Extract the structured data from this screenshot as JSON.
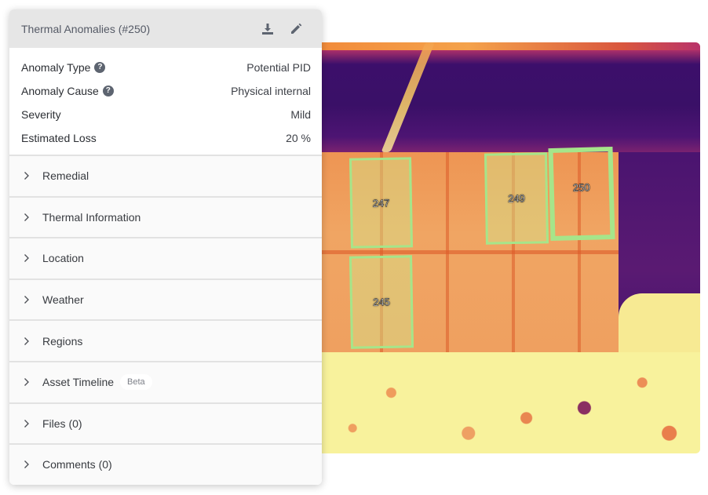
{
  "panel": {
    "title": "Thermal Anomalies (#250)",
    "actions": [
      {
        "name": "download",
        "icon": "download-icon"
      },
      {
        "name": "edit",
        "icon": "pencil-icon"
      }
    ],
    "details": [
      {
        "label": "Anomaly Type",
        "value": "Potential PID",
        "help": true
      },
      {
        "label": "Anomaly Cause",
        "value": "Physical internal",
        "help": true
      },
      {
        "label": "Severity",
        "value": "Mild",
        "help": false
      },
      {
        "label": "Estimated Loss",
        "value": "20 %",
        "help": false
      }
    ],
    "help_glyph": "?",
    "sections": [
      {
        "label": "Remedial"
      },
      {
        "label": "Thermal Information"
      },
      {
        "label": "Location"
      },
      {
        "label": "Weather"
      },
      {
        "label": "Regions"
      },
      {
        "label": "Asset Timeline",
        "badge": "Beta"
      },
      {
        "label": "Files (0)"
      },
      {
        "label": "Comments (0)"
      }
    ]
  },
  "image": {
    "regions": [
      {
        "id": "247",
        "selected": false
      },
      {
        "id": "249",
        "selected": false
      },
      {
        "id": "250",
        "selected": true
      },
      {
        "id": "245",
        "selected": false
      }
    ],
    "colors": {
      "region_outline": "#a6e58a"
    }
  }
}
